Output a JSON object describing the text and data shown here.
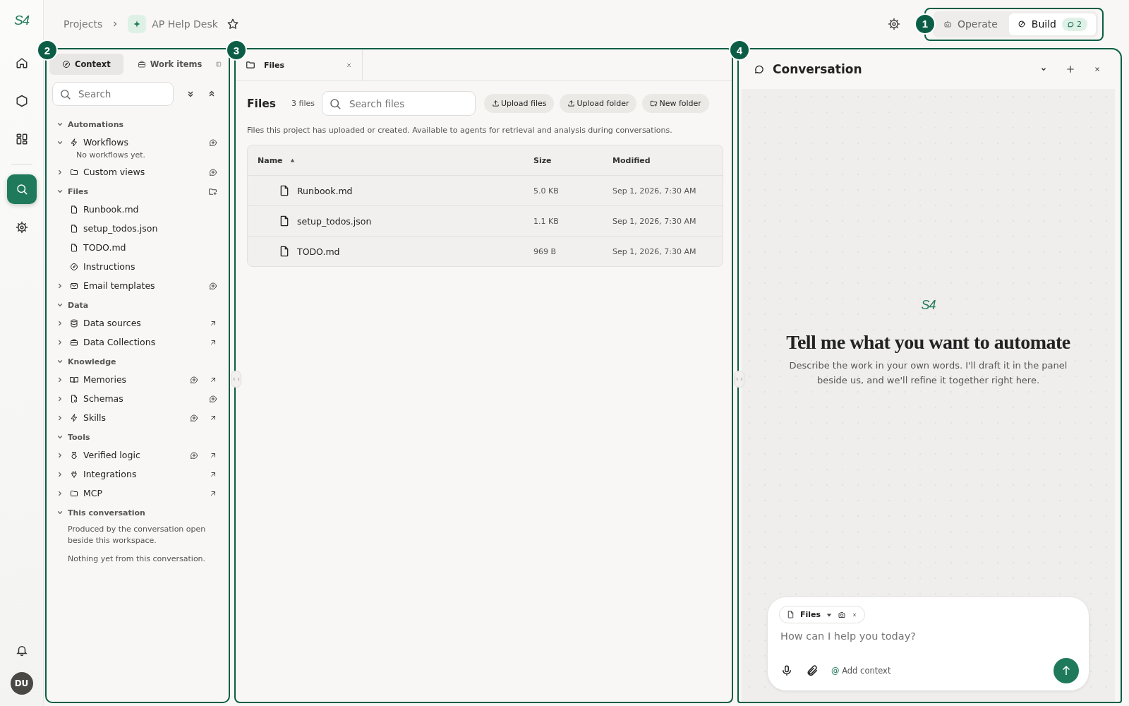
{
  "logo": "S4",
  "rail": {
    "top": [
      {
        "kind": "home",
        "selected": false
      },
      {
        "kind": "hexagon",
        "selected": false
      },
      {
        "kind": "grid",
        "selected": false
      }
    ],
    "tools": [
      {
        "kind": "search",
        "selected": true
      },
      {
        "kind": "gear",
        "selected": false
      }
    ],
    "avatar": "DU"
  },
  "breadcrumb": {
    "root": "Projects",
    "project": "AP Help Desk",
    "starred": false
  },
  "mode_switch": [
    {
      "label": "Operate",
      "kind": "robot",
      "selected": false
    },
    {
      "label": "Build",
      "kind": "build",
      "selected": true,
      "badge": "2"
    }
  ],
  "callouts": [
    "1",
    "2",
    "3",
    "4"
  ],
  "sidebar": {
    "tabs": [
      {
        "label": "Context",
        "kind": "compass",
        "selected": true
      },
      {
        "label": "Work items",
        "kind": "briefcase",
        "selected": false
      }
    ],
    "search": {
      "placeholder": "Search"
    },
    "sections": [
      {
        "title": "Automations",
        "expanded": true,
        "items": [
          {
            "label": "Workflows",
            "kind": "bolt",
            "expanded": true,
            "can_add": true,
            "can_open": false,
            "note": "No workflows yet."
          },
          {
            "label": "Custom views",
            "kind": "folder",
            "expanded": false,
            "can_add": true,
            "can_open": false
          }
        ]
      },
      {
        "title": "Files",
        "expanded": true,
        "add_folder": true,
        "items": [
          {
            "label": "Runbook.md",
            "kind": "file",
            "can_add": false,
            "can_open": false
          },
          {
            "label": "setup_todos.json",
            "kind": "file",
            "can_add": false,
            "can_open": false
          },
          {
            "label": "TODO.md",
            "kind": "file",
            "can_add": false,
            "can_open": false
          },
          {
            "label": "Instructions",
            "kind": "compass",
            "can_add": false,
            "can_open": false
          },
          {
            "label": "Email templates",
            "kind": "envelope",
            "expanded": false,
            "can_add": true,
            "can_open": false
          }
        ]
      },
      {
        "title": "Data",
        "expanded": true,
        "items": [
          {
            "label": "Data sources",
            "kind": "database",
            "expanded": false,
            "can_add": false,
            "can_open": true
          },
          {
            "label": "Data Collections",
            "kind": "briefcase",
            "expanded": false,
            "can_add": false,
            "can_open": true
          }
        ]
      },
      {
        "title": "Knowledge",
        "expanded": true,
        "items": [
          {
            "label": "Memories",
            "kind": "book",
            "expanded": false,
            "can_add": true,
            "can_open": true
          },
          {
            "label": "Schemas",
            "kind": "schema",
            "expanded": false,
            "can_add": true,
            "can_open": false
          },
          {
            "label": "Skills",
            "kind": "bolt",
            "expanded": false,
            "can_add": true,
            "can_open": true
          }
        ]
      },
      {
        "title": "Tools",
        "expanded": true,
        "items": [
          {
            "label": "Verified logic",
            "kind": "medal",
            "expanded": false,
            "can_add": true,
            "can_open": true
          },
          {
            "label": "Integrations",
            "kind": "plug",
            "expanded": false,
            "can_add": false,
            "can_open": true
          },
          {
            "label": "MCP",
            "kind": "folder",
            "expanded": false,
            "can_add": false,
            "can_open": true
          }
        ]
      },
      {
        "title": "This conversation",
        "expanded": true,
        "notes": [
          "Produced by the conversation open beside this workspace.",
          "Nothing yet from this conversation."
        ]
      }
    ]
  },
  "files_panel": {
    "tab": {
      "label": "Files",
      "selected": true
    },
    "title": "Files",
    "count": "3 files",
    "search": {
      "placeholder": "Search files"
    },
    "buttons": [
      {
        "label": "Upload files",
        "kind": "upload"
      },
      {
        "label": "Upload folder",
        "kind": "upload"
      },
      {
        "label": "New folder",
        "kind": "folder-plus"
      }
    ],
    "description": "Files this project has uploaded or created. Available to agents for retrieval and analysis during conversations.",
    "table": {
      "columns": [
        {
          "label": "Name",
          "sorted": true
        },
        {
          "label": "Size",
          "sorted": false
        },
        {
          "label": "Modified",
          "sorted": false
        }
      ],
      "rows": [
        {
          "name": "Runbook.md",
          "size": "5.0 KB",
          "modified": "Sep 1, 2026, 7:30 AM"
        },
        {
          "name": "setup_todos.json",
          "size": "1.1 KB",
          "modified": "Sep 1, 2026, 7:30 AM"
        },
        {
          "name": "TODO.md",
          "size": "969 B",
          "modified": "Sep 1, 2026, 7:30 AM"
        }
      ]
    }
  },
  "conversation": {
    "title": "Conversation",
    "logo": "S4",
    "heading": "Tell me what you want to automate",
    "text": "Describe the work in your own words. I'll draft it in the panel beside us, and we'll refine it together right here.",
    "composer": {
      "chip": "Files",
      "placeholder": "How can I help you today?",
      "at": "@",
      "add_context": "Add context"
    }
  }
}
